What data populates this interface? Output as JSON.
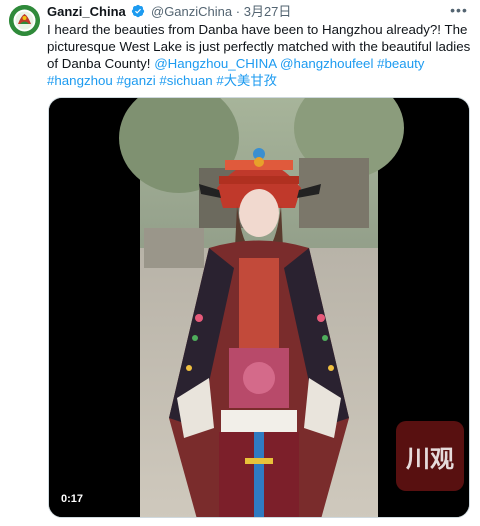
{
  "author": {
    "display_name": "Ganzi_China",
    "handle": "@GanziChina",
    "separator": "·",
    "date": "3月27日",
    "verified": true,
    "avatar_icon": "green-emblem-avatar"
  },
  "more_icon": "more-horizontal-icon",
  "tweet": {
    "text_before": "I heard the beauties from Danba have been to Hangzhou already?! The picturesque West Lake is just perfectly matched with the beautiful ladies of Danba County! ",
    "links": [
      "@Hangzhou_CHINA",
      "@hangzhoufeel",
      "#beauty",
      "#hangzhou",
      "#ganzi",
      "#sichuan",
      "#大美甘孜"
    ]
  },
  "media": {
    "type": "video",
    "duration": "0:17",
    "watermark": "川观"
  },
  "colors": {
    "link": "#1d9bf0",
    "verified": "#1d9bf0",
    "avatar_bg": "#2f8a3a"
  }
}
